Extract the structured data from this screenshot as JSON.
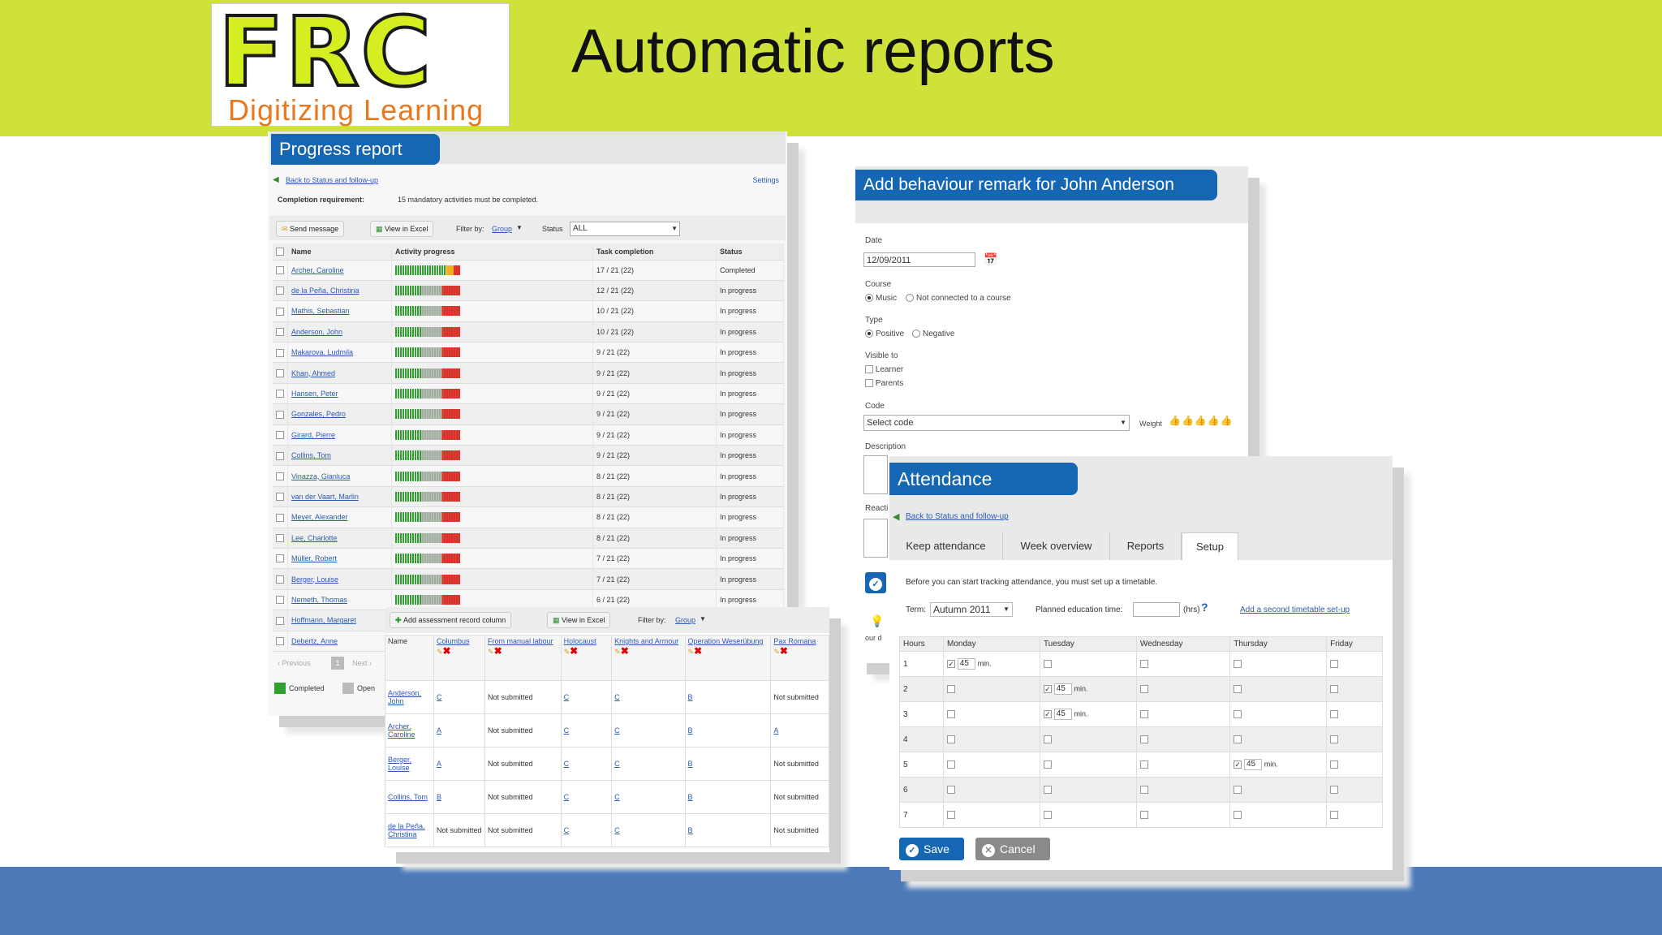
{
  "slide": {
    "title": "Automatic reports",
    "logo_text": "FRC",
    "logo_tagline": "Digitizing Learning",
    "colors": {
      "top_band": "#cfe23a",
      "bottom_band": "#4c7ab8",
      "panel_header": "#1667b3",
      "logo_text": "#d4ee22",
      "tagline": "#e87820"
    }
  },
  "progress": {
    "title": "Progress report",
    "back_link": "Back to Status and follow-up",
    "settings_link": "Settings",
    "requirement_label": "Completion requirement:",
    "requirement_value": "15 mandatory activities must be completed.",
    "send_message": "Send message",
    "view_excel": "View in Excel",
    "filter_label": "Filter by:",
    "filter_value": "Group",
    "status_label": "Status",
    "status_value": "ALL",
    "columns": [
      "Name",
      "Activity progress",
      "Task completion",
      "Status"
    ],
    "rows": [
      {
        "name": "Archer, Caroline",
        "task": "17 / 21 (22)",
        "status": "Completed",
        "bar": "full"
      },
      {
        "name": "de la Peña, Christina",
        "task": "12 / 21 (22)",
        "status": "In progress",
        "bar": "mix"
      },
      {
        "name": "Mathis, Sebastian",
        "task": "10 / 21 (22)",
        "status": "In progress",
        "bar": "mix"
      },
      {
        "name": "Anderson, John",
        "task": "10 / 21 (22)",
        "status": "In progress",
        "bar": "mix"
      },
      {
        "name": "Makarova, Ludmila",
        "task": "9 / 21 (22)",
        "status": "In progress",
        "bar": "mix"
      },
      {
        "name": "Khan, Ahmed",
        "task": "9 / 21 (22)",
        "status": "In progress",
        "bar": "mix"
      },
      {
        "name": "Hansen, Peter",
        "task": "9 / 21 (22)",
        "status": "In progress",
        "bar": "mix"
      },
      {
        "name": "Gonzales, Pedro",
        "task": "9 / 21 (22)",
        "status": "In progress",
        "bar": "mix"
      },
      {
        "name": "Girard, Pierre",
        "task": "9 / 21 (22)",
        "status": "In progress",
        "bar": "mix"
      },
      {
        "name": "Collins, Tom",
        "task": "9 / 21 (22)",
        "status": "In progress",
        "bar": "mix"
      },
      {
        "name": "Vinazza, Gianluca",
        "task": "8 / 21 (22)",
        "status": "In progress",
        "bar": "mix"
      },
      {
        "name": "van der Vaart, Marlin",
        "task": "8 / 21 (22)",
        "status": "In progress",
        "bar": "mix"
      },
      {
        "name": "Meyer, Alexander",
        "task": "8 / 21 (22)",
        "status": "In progress",
        "bar": "mix"
      },
      {
        "name": "Lee, Charlotte",
        "task": "8 / 21 (22)",
        "status": "In progress",
        "bar": "mix"
      },
      {
        "name": "Müller, Robert",
        "task": "7 / 21 (22)",
        "status": "In progress",
        "bar": "mix"
      },
      {
        "name": "Berger, Louise",
        "task": "7 / 21 (22)",
        "status": "In progress",
        "bar": "mix"
      },
      {
        "name": "Nemeth, Thomas",
        "task": "6 / 21 (22)",
        "status": "In progress",
        "bar": "mix"
      },
      {
        "name": "Hoffmann, Margaret",
        "task": "",
        "status": "",
        "bar": "mix"
      },
      {
        "name": "Debertz, Anne",
        "task": "",
        "status": "",
        "bar": "mix"
      }
    ],
    "pager_prev": "‹ Previous",
    "pager_page": "1",
    "pager_next": "Next ›",
    "legend_completed": "Completed",
    "legend_open": "Open"
  },
  "assessment": {
    "add_column": "Add assessment record column",
    "view_excel": "View in Excel",
    "filter_label": "Filter by:",
    "filter_value": "Group",
    "columns": [
      "Name",
      "Columbus",
      "From manual labour",
      "Holocaust",
      "Knights and Armour",
      "Operation Weserübung",
      "Pax Romana"
    ],
    "rows": [
      {
        "name": "Anderson, John",
        "cells": [
          "C",
          "Not submitted",
          "C",
          "C",
          "B",
          "Not submitted"
        ]
      },
      {
        "name": "Archer, Caroline",
        "cells": [
          "A",
          "Not submitted",
          "C",
          "C",
          "B",
          "A"
        ]
      },
      {
        "name": "Berger, Louise",
        "cells": [
          "A",
          "Not submitted",
          "C",
          "C",
          "B",
          "Not submitted"
        ]
      },
      {
        "name": "Collins, Tom",
        "cells": [
          "B",
          "Not submitted",
          "C",
          "C",
          "B",
          "Not submitted"
        ]
      },
      {
        "name": "de la Peña, Christina",
        "cells": [
          "Not submitted",
          "Not submitted",
          "C",
          "C",
          "B",
          "Not submitted"
        ]
      }
    ]
  },
  "behaviour": {
    "title": "Add behaviour remark for John Anderson",
    "date_label": "Date",
    "date_value": "12/09/2011",
    "course_label": "Course",
    "course_opt1": "Music",
    "course_opt2": "Not connected to a course",
    "type_label": "Type",
    "type_opt1": "Positive",
    "type_opt2": "Negative",
    "visible_label": "Visible to",
    "visible_opt1": "Learner",
    "visible_opt2": "Parents",
    "code_label": "Code",
    "code_value": "Select code",
    "weight_label": "Weight",
    "description_label": "Description",
    "reaction_label": "Reacti",
    "hint_text": "our d"
  },
  "attendance": {
    "title": "Attendance",
    "back_link": "Back to Status and follow-up",
    "tabs": [
      "Keep attendance",
      "Week overview",
      "Reports",
      "Setup"
    ],
    "intro": "Before you can start tracking attendance, you must set up a timetable.",
    "term_label": "Term:",
    "term_value": "Autumn 2011",
    "planned_label": "Planned education time:",
    "hrs_label": "(hrs)",
    "help": "?",
    "add_second": "Add a second timetable set-up",
    "columns": [
      "Hours",
      "Monday",
      "Tuesday",
      "Wednesday",
      "Thursday",
      "Friday"
    ],
    "rows": [
      {
        "hour": "1",
        "checked": [
          true,
          false,
          false,
          false,
          false
        ],
        "minutes": [
          "45",
          "",
          "",
          "",
          ""
        ]
      },
      {
        "hour": "2",
        "checked": [
          false,
          true,
          false,
          false,
          false
        ],
        "minutes": [
          "",
          "45",
          "",
          "",
          ""
        ]
      },
      {
        "hour": "3",
        "checked": [
          false,
          true,
          false,
          false,
          false
        ],
        "minutes": [
          "",
          "45",
          "",
          "",
          ""
        ]
      },
      {
        "hour": "4",
        "checked": [
          false,
          false,
          false,
          false,
          false
        ],
        "minutes": [
          "",
          "",
          "",
          "",
          ""
        ]
      },
      {
        "hour": "5",
        "checked": [
          false,
          false,
          false,
          true,
          false
        ],
        "minutes": [
          "",
          "",
          "",
          "45",
          ""
        ]
      },
      {
        "hour": "6",
        "checked": [
          false,
          false,
          false,
          false,
          false
        ],
        "minutes": [
          "",
          "",
          "",
          "",
          ""
        ]
      },
      {
        "hour": "7",
        "checked": [
          false,
          false,
          false,
          false,
          false
        ],
        "minutes": [
          "",
          "",
          "",
          "",
          ""
        ]
      }
    ],
    "min_label": "min.",
    "save": "Save",
    "cancel": "Cancel"
  }
}
